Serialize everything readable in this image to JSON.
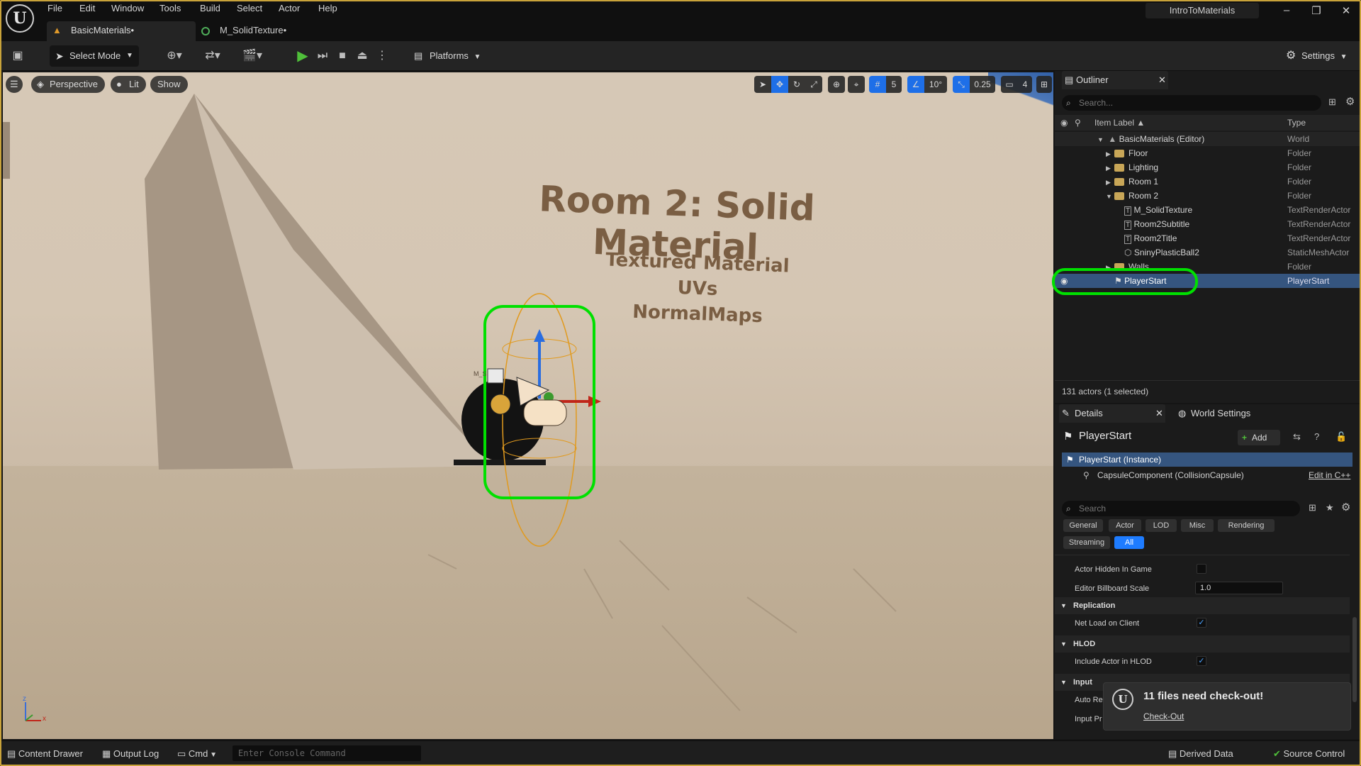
{
  "app": {
    "project_name": "IntroToMaterials",
    "logo": "U"
  },
  "menu": [
    "File",
    "Edit",
    "Window",
    "Tools",
    "Build",
    "Select",
    "Actor",
    "Help"
  ],
  "tabs": [
    {
      "label": "BasicMaterials•"
    },
    {
      "label": "M_SolidTexture•"
    }
  ],
  "toolbar": {
    "select_mode": "Select Mode",
    "platforms": "Platforms",
    "settings": "Settings"
  },
  "viewport": {
    "perspective": "Perspective",
    "lit": "Lit",
    "show": "Show",
    "grid_snap": "5",
    "angle_snap": "10°",
    "scale_snap": "0.25",
    "camera_speed": "4",
    "wall_title": "Room 2: Solid Material",
    "wall_lines": [
      "Textured Material",
      "UVs",
      "NormalMaps"
    ],
    "small_label": "M_S",
    "axis_z": "z",
    "axis_x": "x"
  },
  "outliner": {
    "title": "Outliner",
    "search_placeholder": "Search...",
    "col_label": "Item Label ▲",
    "col_type": "Type",
    "rows": [
      {
        "label": "BasicMaterials (Editor)",
        "type": "World"
      },
      {
        "label": "Floor",
        "type": "Folder"
      },
      {
        "label": "Lighting",
        "type": "Folder"
      },
      {
        "label": "Room 1",
        "type": "Folder"
      },
      {
        "label": "Room 2",
        "type": "Folder"
      },
      {
        "label": "M_SolidTexture",
        "type": "TextRenderActor"
      },
      {
        "label": "Room2Subtitle",
        "type": "TextRenderActor"
      },
      {
        "label": "Room2Title",
        "type": "TextRenderActor"
      },
      {
        "label": "SninyPlasticBall2",
        "type": "StaticMeshActor"
      },
      {
        "label": "Walls",
        "type": "Folder"
      },
      {
        "label": "PlayerStart",
        "type": "PlayerStart"
      }
    ],
    "status": "131 actors (1 selected)"
  },
  "details": {
    "tab_details": "Details",
    "tab_world": "World Settings",
    "actor_name": "PlayerStart",
    "add_label": "Add",
    "instance": "PlayerStart (Instance)",
    "component": "CapsuleComponent (CollisionCapsule)",
    "edit_cpp": "Edit in C++",
    "search_placeholder": "Search",
    "filters": [
      "General",
      "Actor",
      "LOD",
      "Misc",
      "Rendering",
      "Streaming",
      "All"
    ],
    "props": {
      "hidden": "Actor Hidden In Game",
      "billboard": "Editor Billboard Scale",
      "billboard_value": "1.0",
      "replication": "Replication",
      "net_load": "Net Load on Client",
      "hlod": "HLOD",
      "include_hlod": "Include Actor in HLOD",
      "input": "Input",
      "auto_re": "Auto Re",
      "input_pr": "Input Pr"
    }
  },
  "toast": {
    "message": "11 files need check-out!",
    "action": "Check-Out"
  },
  "statusbar": {
    "content_drawer": "Content Drawer",
    "output_log": "Output Log",
    "cmd": "Cmd",
    "console_placeholder": "Enter Console Command",
    "derived_data": "Derived Data",
    "source_control": "Source Control"
  },
  "colors": {
    "highlight": "#00e000",
    "selection": "#35557f",
    "accent": "#1e7cff"
  }
}
